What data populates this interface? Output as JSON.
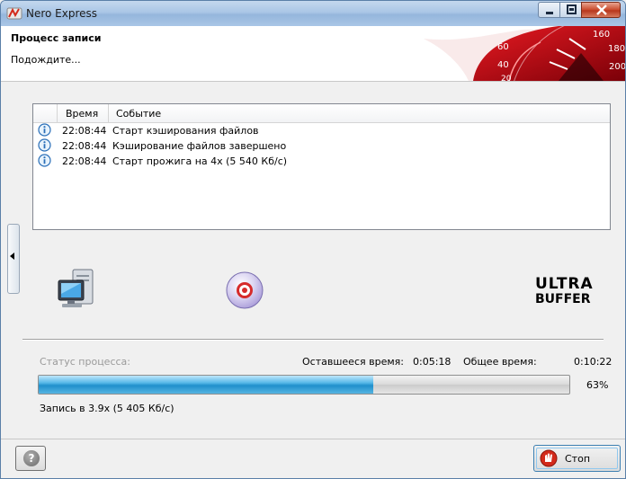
{
  "window": {
    "title": "Nero Express"
  },
  "header": {
    "title": "Процесс записи",
    "subtitle": "Подождите...",
    "speedo_ticks": [
      "160",
      "180",
      "200",
      "60",
      "40",
      "20"
    ]
  },
  "log": {
    "columns": [
      "Время",
      "Событие"
    ],
    "rows": [
      {
        "time": "22:08:44",
        "event": "Старт кэширования файлов"
      },
      {
        "time": "22:08:44",
        "event": "Кэширование файлов завершено"
      },
      {
        "time": "22:08:44",
        "event": "Старт прожига на 4x (5 540 Кб/с)"
      }
    ]
  },
  "brand": {
    "logo_text": "ULTRA BUFFER"
  },
  "status": {
    "label": "Статус процесса:",
    "remaining_label": "Оставшееся время:",
    "remaining_value": "0:05:18",
    "total_label": "Общее время:",
    "total_value": "0:10:22",
    "progress_percent": 63,
    "progress_text": "63%",
    "speed_text": "Запись в 3.9x (5 405 Кб/с)"
  },
  "buttons": {
    "stop_label": "Стоп",
    "help_glyph": "?"
  },
  "colors": {
    "accent_blue": "#1f8fcc",
    "stop_red": "#d32a1b",
    "speedo_red": "#c0101c"
  }
}
